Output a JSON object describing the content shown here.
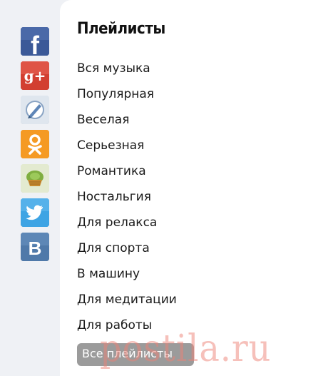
{
  "share": {
    "buttons": [
      {
        "name": "facebook",
        "icon": "facebook-icon",
        "color": "#3b5998"
      },
      {
        "name": "google-plus",
        "icon": "google-plus-icon",
        "color": "#d23f31"
      },
      {
        "name": "livejournal",
        "icon": "livejournal-icon",
        "color": "#cfd8e3"
      },
      {
        "name": "odnoklassniki",
        "icon": "odnoklassniki-icon",
        "color": "#f59a23"
      },
      {
        "name": "liveinternet",
        "icon": "liveinternet-icon",
        "color": "#8db84a"
      },
      {
        "name": "twitter",
        "icon": "twitter-icon",
        "color": "#3ea4e4"
      },
      {
        "name": "vkontakte",
        "icon": "vkontakte-icon",
        "color": "#4f79a9"
      }
    ],
    "glyphs": {
      "facebook": "f",
      "google_plus": "g+",
      "vkontakte": "B"
    }
  },
  "panel": {
    "title": "Плейлисты",
    "playlists": [
      "Вся музыка",
      "Популярная",
      "Веселая",
      "Серьезная",
      "Романтика",
      "Ностальгия",
      "Для релакса",
      "Для спорта",
      "В машину",
      "Для медитации",
      "Для работы"
    ],
    "all_button": "Все плейлисты"
  },
  "watermark": "postila.ru"
}
